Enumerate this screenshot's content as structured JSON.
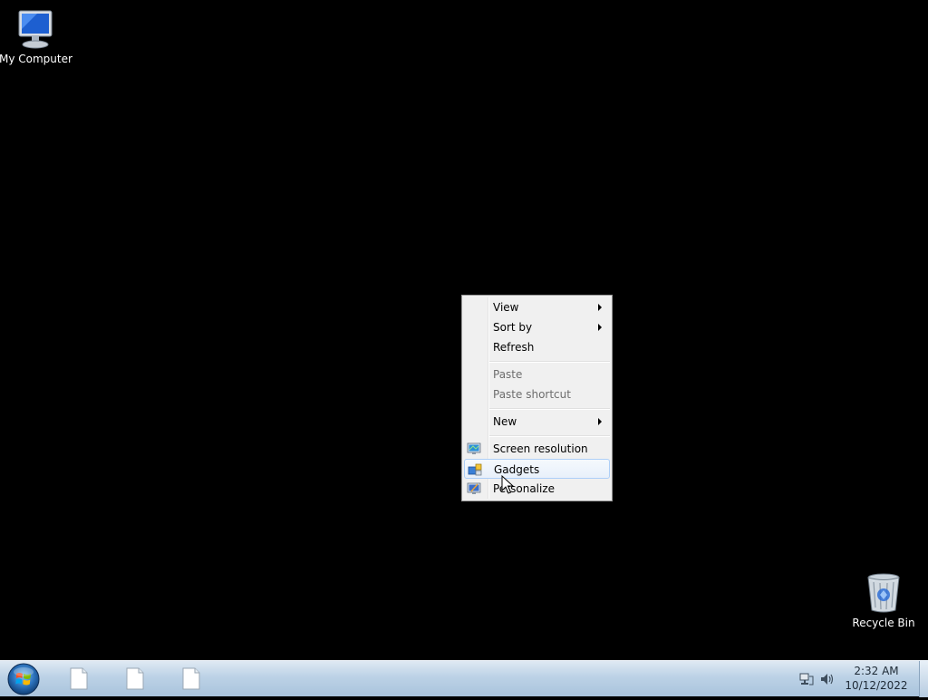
{
  "desktop": {
    "background_color": "#000000",
    "icons": [
      {
        "label": "My Computer",
        "icon": "computer-icon"
      },
      {
        "label": "Recycle Bin",
        "icon": "recycle-bin-icon"
      }
    ]
  },
  "context_menu": {
    "items": [
      {
        "label": "View",
        "submenu": true,
        "disabled": false
      },
      {
        "label": "Sort by",
        "submenu": true,
        "disabled": false
      },
      {
        "label": "Refresh",
        "submenu": false,
        "disabled": false
      },
      {
        "label": "Paste",
        "submenu": false,
        "disabled": true
      },
      {
        "label": "Paste shortcut",
        "submenu": false,
        "disabled": true
      },
      {
        "label": "New",
        "submenu": true,
        "disabled": false
      },
      {
        "label": "Screen resolution",
        "icon": "screen-resolution-icon",
        "disabled": false
      },
      {
        "label": "Gadgets",
        "icon": "gadgets-icon",
        "disabled": false,
        "highlighted": true
      },
      {
        "label": "Personalize",
        "icon": "personalize-icon",
        "disabled": false
      }
    ]
  },
  "taskbar": {
    "start_icon": "windows-start-orb-icon",
    "buttons": [
      {
        "icon": "document-icon"
      },
      {
        "icon": "document-icon"
      },
      {
        "icon": "document-icon"
      }
    ],
    "tray": {
      "icons": [
        "network-icon",
        "volume-icon"
      ],
      "time": "2:32 AM",
      "date": "10/12/2022"
    }
  },
  "colors": {
    "menu_background": "#f0f0f0",
    "menu_highlight_border": "#aecff7",
    "disabled_text": "#6d6d6d",
    "taskbar_top": "#dfe9f3",
    "taskbar_bottom": "#a9c3dc"
  }
}
